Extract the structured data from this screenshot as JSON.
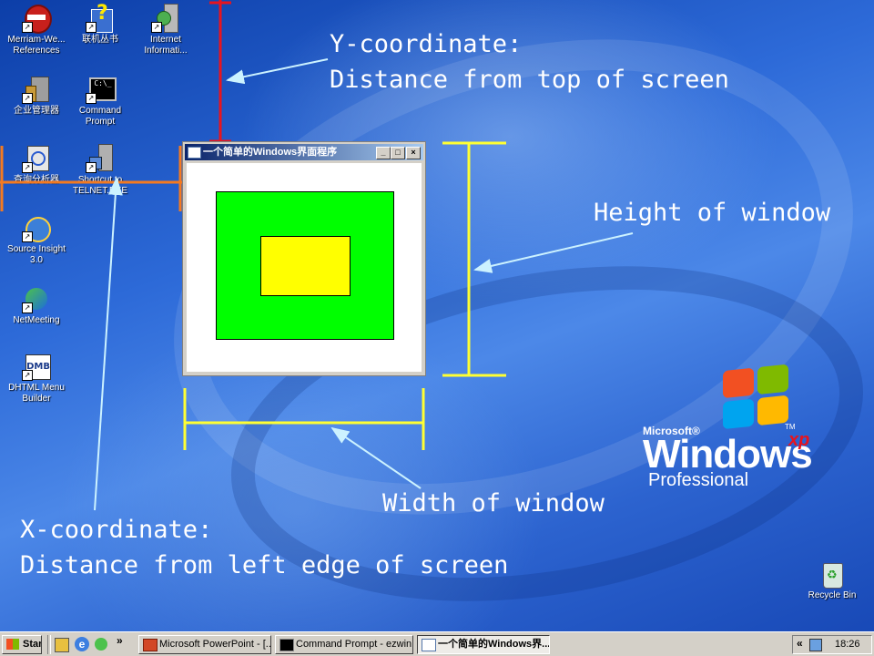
{
  "annotations": {
    "y_coord_title": "Y-coordinate:",
    "y_coord_desc": "Distance from top of screen",
    "height_label": "Height of window",
    "width_label": "Width of window",
    "x_coord_title": "X-coordinate:",
    "x_coord_desc": "Distance from left edge of screen"
  },
  "desktop_icons": {
    "merriam": "Merriam-We...\nReferences",
    "lianji": "联机丛书",
    "iis": "Internet\nInformati...",
    "qiye": "企业管理器",
    "cmd": "Command\nPrompt",
    "chaxun": "查询分析器",
    "telnet": "Shortcut to\nTELNET.EXE",
    "sourceinsight": "Source Insight\n3.0",
    "netmeeting": "NetMeeting",
    "dhtml": "DHTML Menu\nBuilder",
    "recycle": "Recycle Bin"
  },
  "window": {
    "title": "一个简单的Windows界面程序",
    "min": "_",
    "max": "□",
    "close": "×"
  },
  "logo": {
    "microsoft": "Microsoft®",
    "windows": "Windows",
    "xp": "xp",
    "tm": "TM",
    "professional": "Professional"
  },
  "taskbar": {
    "start": "Start",
    "chevron": "»",
    "powerpoint": "Microsoft PowerPoint - [...",
    "command_prompt": "Command Prompt - ezwin",
    "windows_app": "一个简单的Windows界...",
    "tray_chevron": "«",
    "clock": "18:26"
  },
  "colors": {
    "annotation_yellow": "#ffff33",
    "y_marker_red": "#e8141e",
    "x_marker_orange": "#f47a20",
    "green_rect": "#00ff00",
    "yellow_rect": "#ffff00"
  }
}
